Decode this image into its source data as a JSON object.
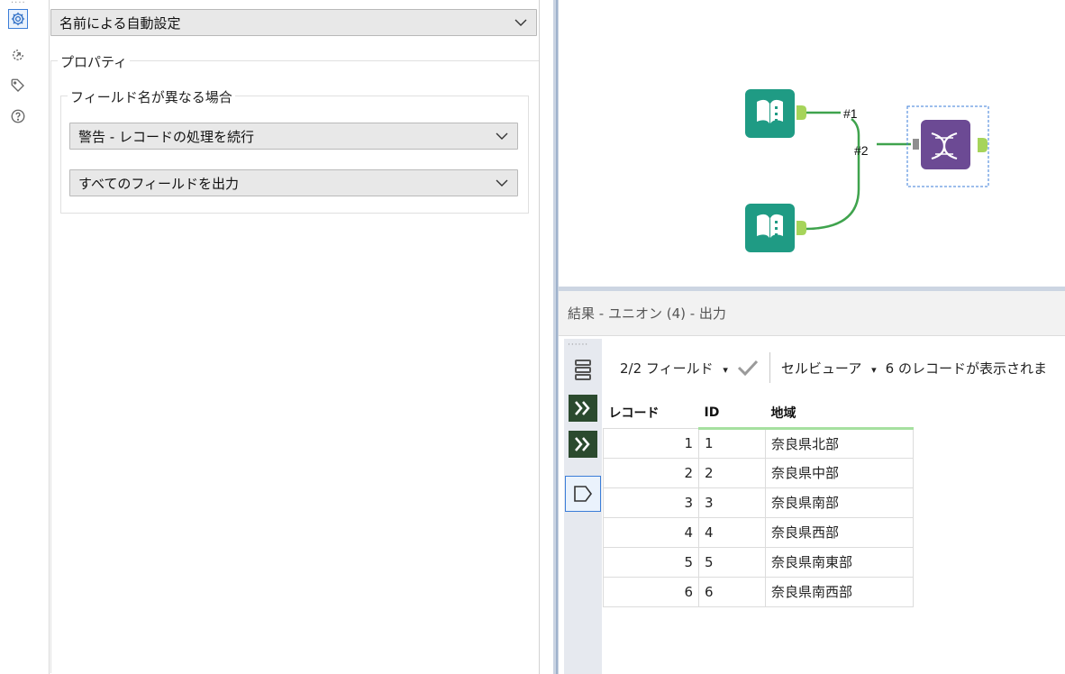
{
  "config": {
    "mode_select": "名前による自動設定",
    "properties_legend": "プロパティ",
    "field_mismatch_legend": "フィールド名が異なる場合",
    "warning_select": "警告 - レコードの処理を続行",
    "output_select": "すべてのフィールドを出力"
  },
  "canvas": {
    "label_1": "#1",
    "label_2": "#2"
  },
  "results": {
    "title": "結果 - ユニオン (4) - 出力",
    "toolbar": {
      "fields": "2/2 フィールド",
      "viewer": "セルビューア",
      "status": "6 のレコードが表示されま"
    },
    "columns": [
      "レコード",
      "ID",
      "地域"
    ],
    "rows": [
      {
        "record": "1",
        "id": "1",
        "region": "奈良県北部"
      },
      {
        "record": "2",
        "id": "2",
        "region": "奈良県中部"
      },
      {
        "record": "3",
        "id": "3",
        "region": "奈良県南部"
      },
      {
        "record": "4",
        "id": "4",
        "region": "奈良県西部"
      },
      {
        "record": "5",
        "id": "5",
        "region": "奈良県南東部"
      },
      {
        "record": "6",
        "id": "6",
        "region": "奈良県南西部"
      }
    ]
  },
  "colors": {
    "accent_blue": "#3b7dd8",
    "tool_teal": "#1f9b84",
    "tool_purple": "#6c4a94",
    "anchor_green": "#a6d45a",
    "conn_green": "#3fa34d",
    "side_dark_green": "#2b4a2e"
  },
  "icons": [
    "gear-icon",
    "cursor-circle-icon",
    "tag-icon",
    "help-icon",
    "chevron-down-icon",
    "book-input-icon",
    "dna-union-icon",
    "list-lines-icon",
    "double-chevron-icon",
    "tag-outline-icon",
    "checkmark-icon",
    "dropdown-arrow-icon"
  ]
}
